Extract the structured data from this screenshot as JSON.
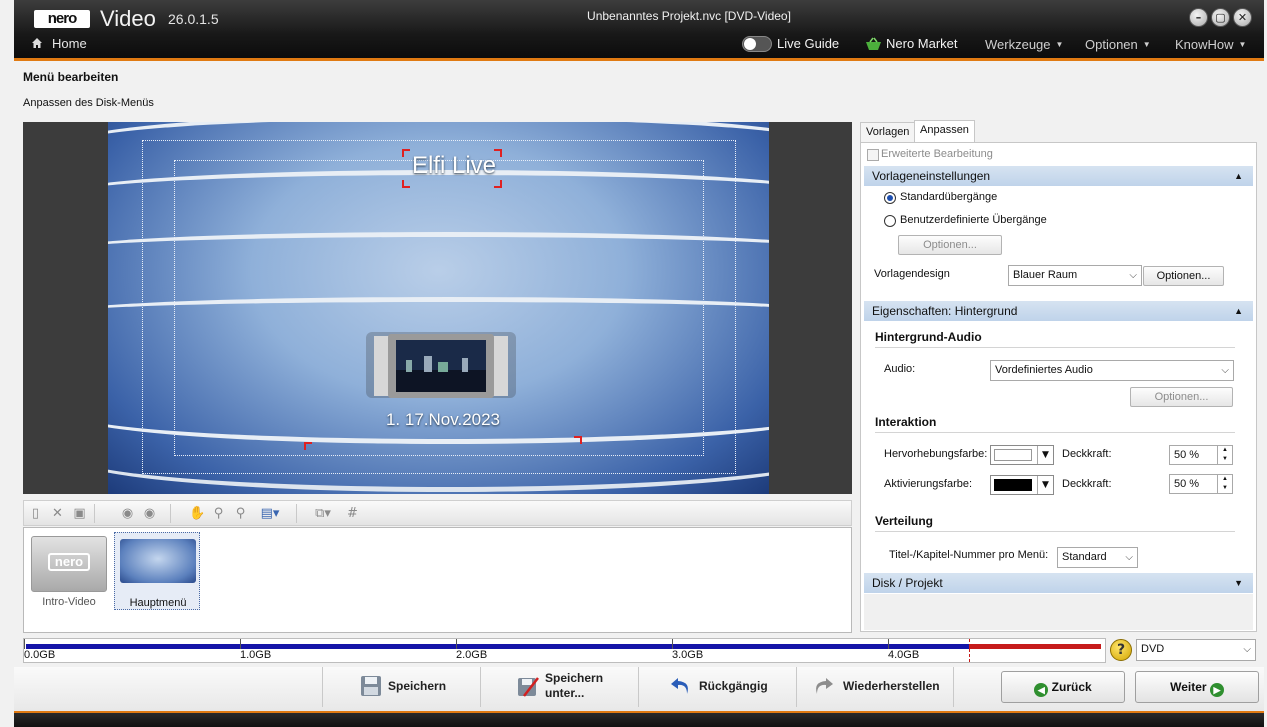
{
  "app": {
    "logo": "nero",
    "name": "Video",
    "version": "26.0.1.5",
    "window_title": "Unbenanntes Projekt.nvc [DVD-Video]"
  },
  "nav": {
    "home": "Home",
    "live_guide": "Live Guide",
    "market": "Nero Market",
    "menus": [
      "Werkzeuge",
      "Optionen",
      "KnowHow"
    ]
  },
  "page": {
    "title": "Menü bearbeiten",
    "subtitle": "Anpassen des Disk-Menüs"
  },
  "preview": {
    "menu_title": "Elfi Live",
    "chapter_label": "1. 17.Nov.2023"
  },
  "thumbnails": [
    {
      "label": "Intro-Video",
      "logo": "nero"
    },
    {
      "label": "Hauptmenü"
    }
  ],
  "panel": {
    "tabs": [
      "Vorlagen",
      "Anpassen"
    ],
    "advanced_edit": "Erweiterte Bearbeitung",
    "template_settings": {
      "header": "Vorlageneinstellungen",
      "radio_standard": "Standardübergänge",
      "radio_custom": "Benutzerdefinierte Übergänge",
      "options_btn": "Optionen...",
      "design_label": "Vorlagendesign",
      "design_value": "Blauer Raum",
      "design_options_btn": "Optionen..."
    },
    "background": {
      "header": "Eigenschaften: Hintergrund",
      "audio_header": "Hintergrund-Audio",
      "audio_label": "Audio:",
      "audio_value": "Vordefiniertes Audio",
      "audio_options_btn": "Optionen...",
      "interaction_header": "Interaktion",
      "highlight_label": "Hervorhebungsfarbe:",
      "highlight_color": "#ffffff",
      "activation_label": "Aktivierungsfarbe:",
      "activation_color": "#000000",
      "opacity_label": "Deckkraft:",
      "highlight_opacity": "50 %",
      "activation_opacity": "50 %",
      "distribution_header": "Verteilung",
      "titles_label": "Titel-/Kapitel-Nummer pro Menü:",
      "titles_value": "Standard"
    },
    "disc_header": "Disk / Projekt"
  },
  "capacity": {
    "labels": [
      "0.0GB",
      "1.0GB",
      "2.0GB",
      "3.0GB",
      "4.0GB"
    ],
    "used_fraction": 0.875,
    "disc_type": "DVD"
  },
  "bottom": {
    "save": "Speichern",
    "save_as": "Speichern unter...",
    "undo": "Rückgängig",
    "redo": "Wiederherstellen",
    "back": "Zurück",
    "next": "Weiter"
  },
  "colors": {
    "accent": "#e07a12",
    "section": "#c9dbef"
  }
}
